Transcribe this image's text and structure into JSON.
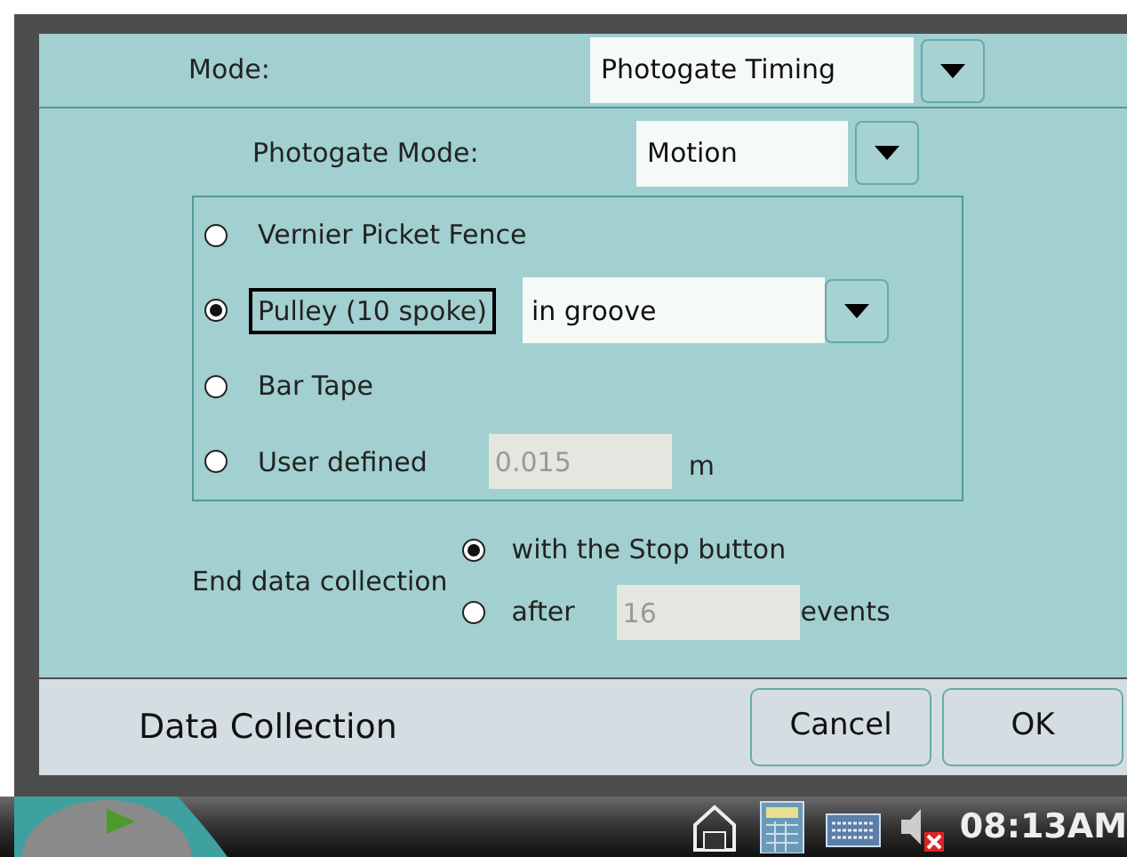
{
  "mode": {
    "label": "Mode:",
    "value": "Photogate Timing"
  },
  "photogate_mode": {
    "label": "Photogate Mode:",
    "value": "Motion"
  },
  "options": [
    {
      "kind": "plain",
      "label": "Vernier Picket Fence",
      "selected": false,
      "focused": false
    },
    {
      "kind": "dropdown",
      "label": "Pulley (10 spoke)",
      "selected": true,
      "focused": true,
      "value": "in groove"
    },
    {
      "kind": "plain",
      "label": "Bar Tape",
      "selected": false,
      "focused": false
    },
    {
      "kind": "input",
      "label": "User defined",
      "selected": false,
      "focused": false,
      "value": "0.015",
      "unit": "m"
    }
  ],
  "end_collection": {
    "label": "End data collection",
    "choices": [
      {
        "kind": "plain",
        "label": "with the Stop button",
        "selected": true
      },
      {
        "kind": "input",
        "label": "after",
        "selected": false,
        "value": "16",
        "unit": "events"
      }
    ]
  },
  "footer": {
    "title": "Data Collection",
    "buttons": [
      "Cancel",
      "OK"
    ]
  },
  "taskbar": {
    "clock": "08:13AM"
  }
}
